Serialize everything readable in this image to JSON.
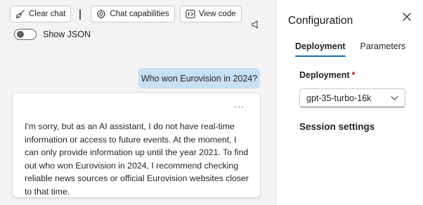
{
  "toolbar": {
    "clear_chat_label": "Clear chat",
    "chat_capabilities_label": "Chat capabilities",
    "view_code_label": "View code"
  },
  "json_toggle": {
    "label": "Show JSON",
    "checked": false
  },
  "conversation": {
    "user_message": "Who won Eurovision in 2024?",
    "assistant_more": "...",
    "assistant_message": "I'm sorry, but as an AI assistant, I do not have real-time information or access to future events. At the moment, I can only provide information up until the year 2021. To find out who won Eurovision in 2024, I recommend checking reliable news sources or official Eurovision websites closer to that time."
  },
  "config": {
    "title": "Configuration",
    "tabs": [
      {
        "label": "Deployment",
        "active": true
      },
      {
        "label": "Parameters",
        "active": false
      }
    ],
    "deployment_label": "Deployment",
    "required_marker": "*",
    "deployment_value": "gpt-35-turbo-16k",
    "session_heading": "Session settings"
  },
  "icons": {
    "clear_chat": "broom-icon",
    "chat_capabilities": "gear-icon",
    "view_code": "code-icon",
    "speaker": "speaker-icon",
    "close": "close-icon",
    "dropdown": "chevron-down-icon"
  },
  "colors": {
    "accent": "#0f6cbd",
    "user_bubble": "#c7e0f4",
    "required": "#c50f1f",
    "chat_background": "#f3f3f3"
  }
}
